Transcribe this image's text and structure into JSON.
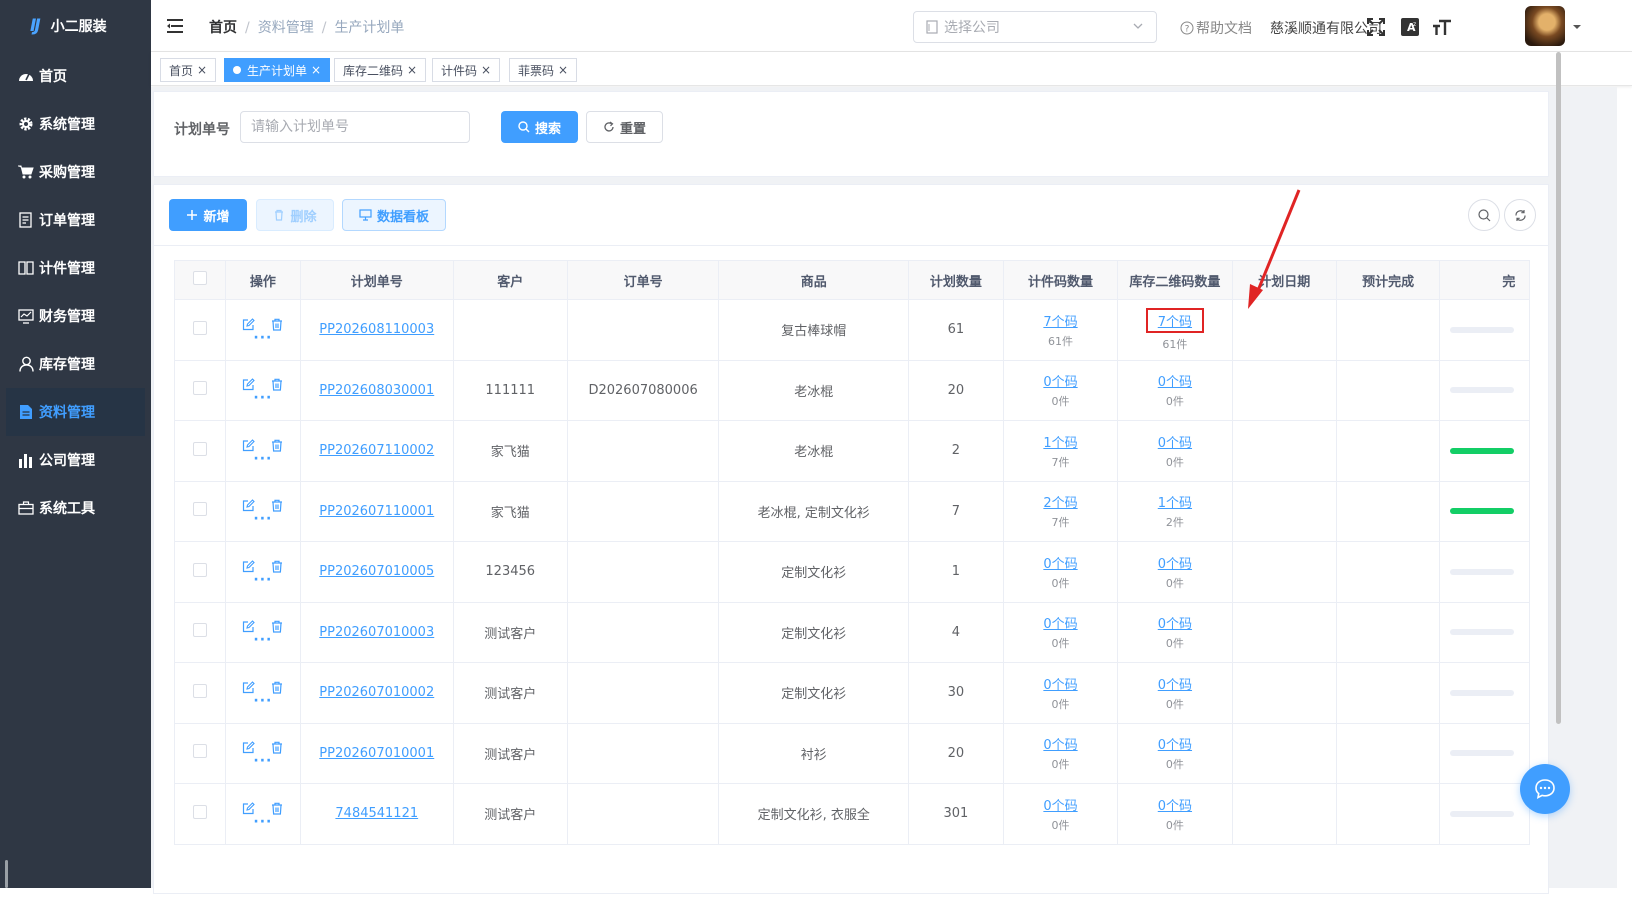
{
  "app": {
    "logo_mark": "IJ",
    "name": "小二服装"
  },
  "sidebar": {
    "items": [
      {
        "label": "首页",
        "icon": "dashboard-icon"
      },
      {
        "label": "系统管理",
        "icon": "gear-icon"
      },
      {
        "label": "采购管理",
        "icon": "cart-icon"
      },
      {
        "label": "订单管理",
        "icon": "order-icon"
      },
      {
        "label": "计件管理",
        "icon": "book-icon"
      },
      {
        "label": "财务管理",
        "icon": "finance-icon"
      },
      {
        "label": "库存管理",
        "icon": "user-icon"
      },
      {
        "label": "资料管理",
        "icon": "document-icon",
        "active": true
      },
      {
        "label": "公司管理",
        "icon": "bar-chart-icon"
      },
      {
        "label": "系统工具",
        "icon": "toolbox-icon"
      }
    ]
  },
  "header": {
    "breadcrumb": [
      "首页",
      "资料管理",
      "生产计划单"
    ],
    "company_select_placeholder": "选择公司",
    "help": "帮助文档",
    "company": "慈溪顺通有限公司"
  },
  "tags": [
    {
      "label": "首页",
      "active": false
    },
    {
      "label": "生产计划单",
      "active": true
    },
    {
      "label": "库存二维码",
      "active": false
    },
    {
      "label": "计件码",
      "active": false
    },
    {
      "label": "菲票码",
      "active": false
    }
  ],
  "search": {
    "label": "计划单号",
    "placeholder": "请输入计划单号",
    "search_btn": "搜索",
    "reset_btn": "重置"
  },
  "toolbar": {
    "add": "新增",
    "delete": "删除",
    "board": "数据看板"
  },
  "table": {
    "headers": [
      "操作",
      "计划单号",
      "客户",
      "订单号",
      "商品",
      "计划数量",
      "计件码数量",
      "库存二维码数量",
      "计划日期",
      "预计完成",
      "完"
    ],
    "rows": [
      {
        "plan_no": "PP202608110003",
        "customer": "",
        "order_no": "",
        "goods": "复古棒球帽",
        "qty": "61",
        "piece_codes": "7个码",
        "piece_count": "61件",
        "stock_codes": "7个码",
        "stock_count": "61件",
        "progress": 0
      },
      {
        "plan_no": "PP202608030001",
        "customer": "111111",
        "order_no": "D202607080006",
        "goods": "老冰棍",
        "qty": "20",
        "piece_codes": "0个码",
        "piece_count": "0件",
        "stock_codes": "0个码",
        "stock_count": "0件",
        "progress": 0
      },
      {
        "plan_no": "PP202607110002",
        "customer": "家飞猫",
        "order_no": "",
        "goods": "老冰棍",
        "qty": "2",
        "piece_codes": "1个码",
        "piece_count": "7件",
        "stock_codes": "0个码",
        "stock_count": "0件",
        "progress": 100
      },
      {
        "plan_no": "PP202607110001",
        "customer": "家飞猫",
        "order_no": "",
        "goods": "老冰棍, 定制文化衫",
        "qty": "7",
        "piece_codes": "2个码",
        "piece_count": "7件",
        "stock_codes": "1个码",
        "stock_count": "2件",
        "progress": 100
      },
      {
        "plan_no": "PP202607010005",
        "customer": "123456",
        "order_no": "",
        "goods": "定制文化衫",
        "qty": "1",
        "piece_codes": "0个码",
        "piece_count": "0件",
        "stock_codes": "0个码",
        "stock_count": "0件",
        "progress": 0
      },
      {
        "plan_no": "PP202607010003",
        "customer": "测试客户",
        "order_no": "",
        "goods": "定制文化衫",
        "qty": "4",
        "piece_codes": "0个码",
        "piece_count": "0件",
        "stock_codes": "0个码",
        "stock_count": "0件",
        "progress": 0
      },
      {
        "plan_no": "PP202607010002",
        "customer": "测试客户",
        "order_no": "",
        "goods": "定制文化衫",
        "qty": "30",
        "piece_codes": "0个码",
        "piece_count": "0件",
        "stock_codes": "0个码",
        "stock_count": "0件",
        "progress": 0
      },
      {
        "plan_no": "PP202607010001",
        "customer": "测试客户",
        "order_no": "",
        "goods": "衬衫",
        "qty": "20",
        "piece_codes": "0个码",
        "piece_count": "0件",
        "stock_codes": "0个码",
        "stock_count": "0件",
        "progress": 0
      },
      {
        "plan_no": "7484541121",
        "customer": "测试客户",
        "order_no": "",
        "goods": "定制文化衫, 衣服全",
        "qty": "301",
        "piece_codes": "0个码",
        "piece_count": "0件",
        "stock_codes": "0个码",
        "stock_count": "0件",
        "progress": 0
      }
    ]
  },
  "colors": {
    "primary": "#409eff",
    "sidebar_bg": "#2f3744",
    "success": "#13ce66",
    "annotation": "#e02424"
  }
}
